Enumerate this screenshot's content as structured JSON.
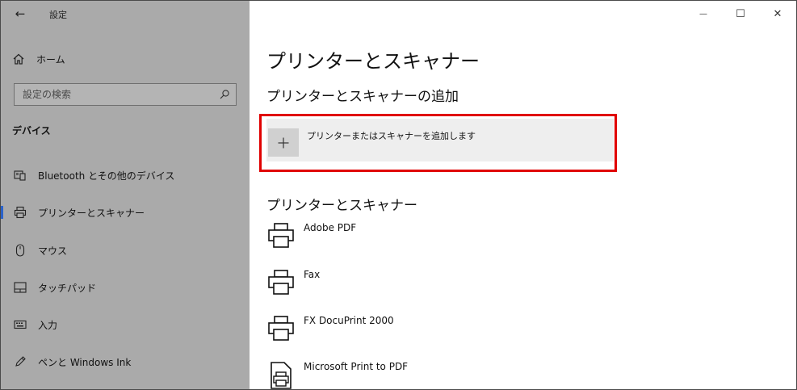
{
  "window": {
    "app_title": "設定",
    "back_glyph": "←",
    "minimize_glyph": "—",
    "maximize_glyph": "☐",
    "close_glyph": "✕"
  },
  "sidebar": {
    "home_label": "ホーム",
    "search_placeholder": "設定の検索",
    "section_heading": "デバイス",
    "items": [
      {
        "label": "Bluetooth とその他のデバイス",
        "icon": "bluetooth-devices-icon",
        "selected": false
      },
      {
        "label": "プリンターとスキャナー",
        "icon": "printer-icon",
        "selected": true
      },
      {
        "label": "マウス",
        "icon": "mouse-icon",
        "selected": false
      },
      {
        "label": "タッチパッド",
        "icon": "touchpad-icon",
        "selected": false
      },
      {
        "label": "入力",
        "icon": "keyboard-icon",
        "selected": false
      },
      {
        "label": "ペンと Windows Ink",
        "icon": "pen-icon",
        "selected": false
      }
    ]
  },
  "main": {
    "page_title": "プリンターとスキャナー",
    "add_heading": "プリンターとスキャナーの追加",
    "add_button_label": "プリンターまたはスキャナーを追加します",
    "list_heading": "プリンターとスキャナー",
    "printers": [
      {
        "name": "Adobe PDF",
        "icon": "printer-icon"
      },
      {
        "name": "Fax",
        "icon": "printer-icon"
      },
      {
        "name": "FX DocuPrint 2000",
        "icon": "printer-icon"
      },
      {
        "name": "Microsoft Print to PDF",
        "icon": "pdf-printer-icon"
      }
    ]
  },
  "colors": {
    "sidebar_bg": "#aaaaaa",
    "accent": "#2a62c9",
    "highlight_border": "#e00000",
    "add_card_bg": "#eeeeee"
  }
}
